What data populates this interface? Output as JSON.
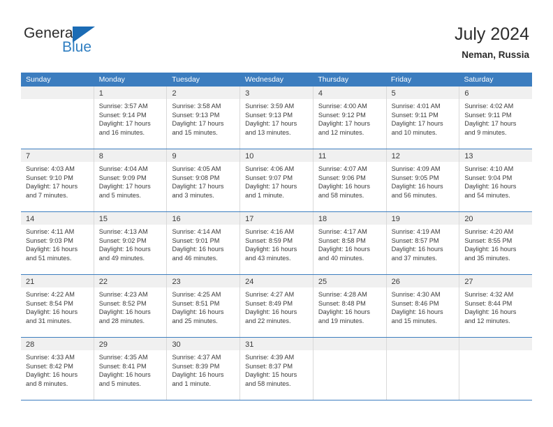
{
  "brand": {
    "name_part1": "General",
    "name_part2": "Blue",
    "triangle_color": "#1b6cb5",
    "blue_text_color": "#2f7ec1"
  },
  "header": {
    "title": "July 2024",
    "subtitle": "Neman, Russia"
  },
  "theme": {
    "header_row_bg": "#3c7dbf",
    "day_band_bg": "#f0f0f0",
    "text_color": "#3a3a3a",
    "grid_line": "#d9d9d9"
  },
  "weekdays": [
    "Sunday",
    "Monday",
    "Tuesday",
    "Wednesday",
    "Thursday",
    "Friday",
    "Saturday"
  ],
  "weeks": [
    [
      {
        "day": "",
        "empty": true,
        "sunrise": "",
        "sunset": "",
        "daylight1": "",
        "daylight2": ""
      },
      {
        "day": "1",
        "sunrise": "Sunrise: 3:57 AM",
        "sunset": "Sunset: 9:14 PM",
        "daylight1": "Daylight: 17 hours",
        "daylight2": "and 16 minutes."
      },
      {
        "day": "2",
        "sunrise": "Sunrise: 3:58 AM",
        "sunset": "Sunset: 9:13 PM",
        "daylight1": "Daylight: 17 hours",
        "daylight2": "and 15 minutes."
      },
      {
        "day": "3",
        "sunrise": "Sunrise: 3:59 AM",
        "sunset": "Sunset: 9:13 PM",
        "daylight1": "Daylight: 17 hours",
        "daylight2": "and 13 minutes."
      },
      {
        "day": "4",
        "sunrise": "Sunrise: 4:00 AM",
        "sunset": "Sunset: 9:12 PM",
        "daylight1": "Daylight: 17 hours",
        "daylight2": "and 12 minutes."
      },
      {
        "day": "5",
        "sunrise": "Sunrise: 4:01 AM",
        "sunset": "Sunset: 9:11 PM",
        "daylight1": "Daylight: 17 hours",
        "daylight2": "and 10 minutes."
      },
      {
        "day": "6",
        "sunrise": "Sunrise: 4:02 AM",
        "sunset": "Sunset: 9:11 PM",
        "daylight1": "Daylight: 17 hours",
        "daylight2": "and 9 minutes."
      }
    ],
    [
      {
        "day": "7",
        "sunrise": "Sunrise: 4:03 AM",
        "sunset": "Sunset: 9:10 PM",
        "daylight1": "Daylight: 17 hours",
        "daylight2": "and 7 minutes."
      },
      {
        "day": "8",
        "sunrise": "Sunrise: 4:04 AM",
        "sunset": "Sunset: 9:09 PM",
        "daylight1": "Daylight: 17 hours",
        "daylight2": "and 5 minutes."
      },
      {
        "day": "9",
        "sunrise": "Sunrise: 4:05 AM",
        "sunset": "Sunset: 9:08 PM",
        "daylight1": "Daylight: 17 hours",
        "daylight2": "and 3 minutes."
      },
      {
        "day": "10",
        "sunrise": "Sunrise: 4:06 AM",
        "sunset": "Sunset: 9:07 PM",
        "daylight1": "Daylight: 17 hours",
        "daylight2": "and 1 minute."
      },
      {
        "day": "11",
        "sunrise": "Sunrise: 4:07 AM",
        "sunset": "Sunset: 9:06 PM",
        "daylight1": "Daylight: 16 hours",
        "daylight2": "and 58 minutes."
      },
      {
        "day": "12",
        "sunrise": "Sunrise: 4:09 AM",
        "sunset": "Sunset: 9:05 PM",
        "daylight1": "Daylight: 16 hours",
        "daylight2": "and 56 minutes."
      },
      {
        "day": "13",
        "sunrise": "Sunrise: 4:10 AM",
        "sunset": "Sunset: 9:04 PM",
        "daylight1": "Daylight: 16 hours",
        "daylight2": "and 54 minutes."
      }
    ],
    [
      {
        "day": "14",
        "sunrise": "Sunrise: 4:11 AM",
        "sunset": "Sunset: 9:03 PM",
        "daylight1": "Daylight: 16 hours",
        "daylight2": "and 51 minutes."
      },
      {
        "day": "15",
        "sunrise": "Sunrise: 4:13 AM",
        "sunset": "Sunset: 9:02 PM",
        "daylight1": "Daylight: 16 hours",
        "daylight2": "and 49 minutes."
      },
      {
        "day": "16",
        "sunrise": "Sunrise: 4:14 AM",
        "sunset": "Sunset: 9:01 PM",
        "daylight1": "Daylight: 16 hours",
        "daylight2": "and 46 minutes."
      },
      {
        "day": "17",
        "sunrise": "Sunrise: 4:16 AM",
        "sunset": "Sunset: 8:59 PM",
        "daylight1": "Daylight: 16 hours",
        "daylight2": "and 43 minutes."
      },
      {
        "day": "18",
        "sunrise": "Sunrise: 4:17 AM",
        "sunset": "Sunset: 8:58 PM",
        "daylight1": "Daylight: 16 hours",
        "daylight2": "and 40 minutes."
      },
      {
        "day": "19",
        "sunrise": "Sunrise: 4:19 AM",
        "sunset": "Sunset: 8:57 PM",
        "daylight1": "Daylight: 16 hours",
        "daylight2": "and 37 minutes."
      },
      {
        "day": "20",
        "sunrise": "Sunrise: 4:20 AM",
        "sunset": "Sunset: 8:55 PM",
        "daylight1": "Daylight: 16 hours",
        "daylight2": "and 35 minutes."
      }
    ],
    [
      {
        "day": "21",
        "sunrise": "Sunrise: 4:22 AM",
        "sunset": "Sunset: 8:54 PM",
        "daylight1": "Daylight: 16 hours",
        "daylight2": "and 31 minutes."
      },
      {
        "day": "22",
        "sunrise": "Sunrise: 4:23 AM",
        "sunset": "Sunset: 8:52 PM",
        "daylight1": "Daylight: 16 hours",
        "daylight2": "and 28 minutes."
      },
      {
        "day": "23",
        "sunrise": "Sunrise: 4:25 AM",
        "sunset": "Sunset: 8:51 PM",
        "daylight1": "Daylight: 16 hours",
        "daylight2": "and 25 minutes."
      },
      {
        "day": "24",
        "sunrise": "Sunrise: 4:27 AM",
        "sunset": "Sunset: 8:49 PM",
        "daylight1": "Daylight: 16 hours",
        "daylight2": "and 22 minutes."
      },
      {
        "day": "25",
        "sunrise": "Sunrise: 4:28 AM",
        "sunset": "Sunset: 8:48 PM",
        "daylight1": "Daylight: 16 hours",
        "daylight2": "and 19 minutes."
      },
      {
        "day": "26",
        "sunrise": "Sunrise: 4:30 AM",
        "sunset": "Sunset: 8:46 PM",
        "daylight1": "Daylight: 16 hours",
        "daylight2": "and 15 minutes."
      },
      {
        "day": "27",
        "sunrise": "Sunrise: 4:32 AM",
        "sunset": "Sunset: 8:44 PM",
        "daylight1": "Daylight: 16 hours",
        "daylight2": "and 12 minutes."
      }
    ],
    [
      {
        "day": "28",
        "sunrise": "Sunrise: 4:33 AM",
        "sunset": "Sunset: 8:42 PM",
        "daylight1": "Daylight: 16 hours",
        "daylight2": "and 8 minutes."
      },
      {
        "day": "29",
        "sunrise": "Sunrise: 4:35 AM",
        "sunset": "Sunset: 8:41 PM",
        "daylight1": "Daylight: 16 hours",
        "daylight2": "and 5 minutes."
      },
      {
        "day": "30",
        "sunrise": "Sunrise: 4:37 AM",
        "sunset": "Sunset: 8:39 PM",
        "daylight1": "Daylight: 16 hours",
        "daylight2": "and 1 minute."
      },
      {
        "day": "31",
        "sunrise": "Sunrise: 4:39 AM",
        "sunset": "Sunset: 8:37 PM",
        "daylight1": "Daylight: 15 hours",
        "daylight2": "and 58 minutes."
      },
      {
        "day": "",
        "empty": true,
        "sunrise": "",
        "sunset": "",
        "daylight1": "",
        "daylight2": ""
      },
      {
        "day": "",
        "empty": true,
        "sunrise": "",
        "sunset": "",
        "daylight1": "",
        "daylight2": ""
      },
      {
        "day": "",
        "empty": true,
        "sunrise": "",
        "sunset": "",
        "daylight1": "",
        "daylight2": ""
      }
    ]
  ]
}
